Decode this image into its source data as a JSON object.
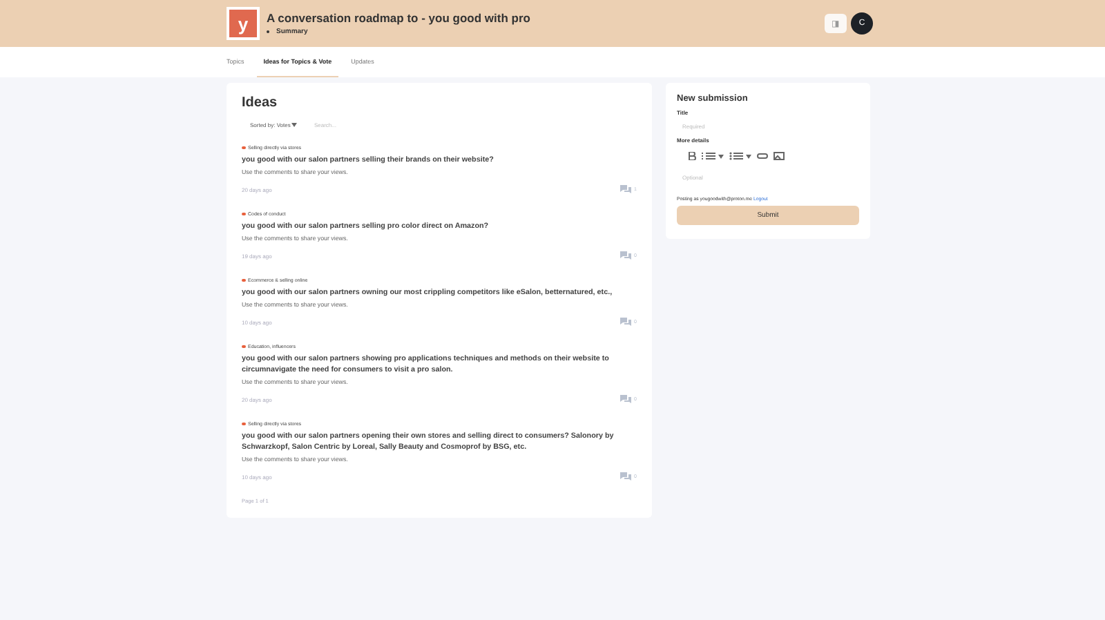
{
  "header": {
    "logo": "y",
    "title": "A conversation roadmap to - you good with pro",
    "subtitle": "Summary",
    "icon_button": "◨",
    "avatar": "C"
  },
  "tabs": [
    {
      "label": "Topics",
      "selected": false
    },
    {
      "label": "Ideas for Topics & Vote",
      "selected": true
    },
    {
      "label": "Updates",
      "selected": false
    }
  ],
  "ideas": {
    "title": "Ideas",
    "sort": "Sorted by: Votes",
    "search": {
      "placeholder": "Search..."
    },
    "items": [
      {
        "category": "Selling directly via stores",
        "color": "#e8603c",
        "title": "you good with our salon partners selling their brands on their website?",
        "body": "Use the comments to share your views.",
        "time": "20 days ago",
        "comments": "1"
      },
      {
        "category": "Codes of conduct",
        "color": "#e8603c",
        "title": "you good with our salon partners selling pro color direct on Amazon?",
        "body": "Use the comments to share your views.",
        "time": "19 days ago",
        "comments": "0"
      },
      {
        "category": "Ecommerce & selling online",
        "color": "#e8603c",
        "title": "you good with our salon partners owning our most crippling competitors like eSalon, betternatured, etc.,",
        "body": "Use the comments to share your views.",
        "time": "10 days ago",
        "comments": "0"
      },
      {
        "category": "Education, influencers",
        "color": "#e8603c",
        "title": "you good with our salon partners showing pro applications techniques and methods on their website to circumnavigate the need for consumers to visit a pro salon.",
        "body": "Use the comments to share your views.",
        "time": "20 days ago",
        "comments": "0"
      },
      {
        "category": "Selling directly via stores",
        "color": "#e8603c",
        "title": "you good with our salon partners opening their own stores and selling direct to consumers? Salonory by Schwarzkopf,  Salon Centric by Loreal, Sally Beauty and Cosmoprof by BSG, etc.",
        "body": "Use the comments to share your views.",
        "time": "10 days ago",
        "comments": "0"
      }
    ],
    "pagination": "Page 1 of 1"
  },
  "submission": {
    "title": "New submission",
    "title_label": "Title",
    "title_field": {
      "placeholder": "Required"
    },
    "details_label": "More details",
    "details_field": {
      "placeholder": "Optional"
    },
    "posting_as": "Posting as yougoodwith@proton.me",
    "logout": "Logout",
    "submit": "Submit"
  }
}
